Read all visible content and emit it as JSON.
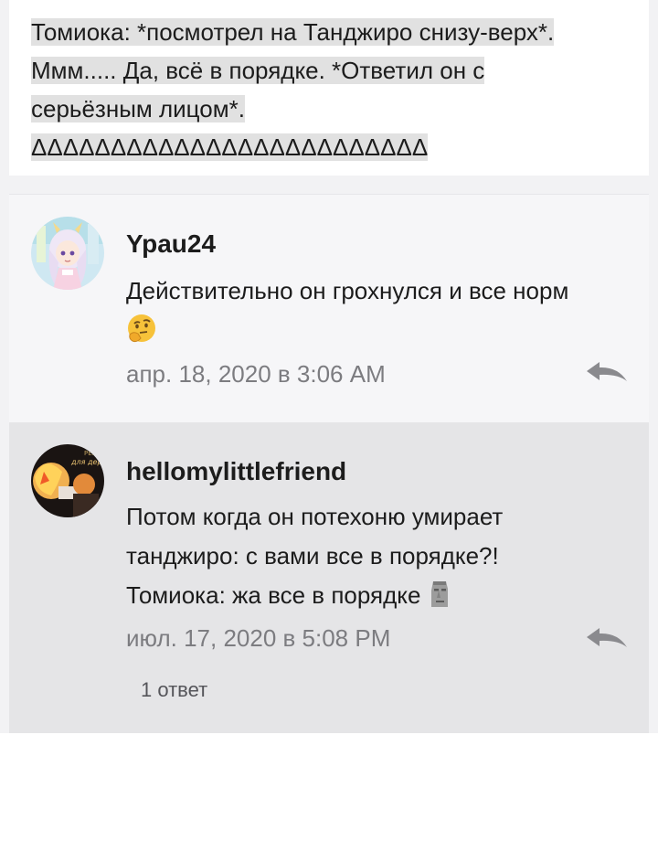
{
  "post": {
    "line1": "Томиока: *посмотрел на Танджиро снизу-верх*.",
    "line2": "Ммм..... Да, всё в порядке. *Ответил он с",
    "line3": "серьёзным лицом*.",
    "line4": "ΔΔΔΔΔΔΔΔΔΔΔΔΔΔΔΔΔΔΔΔΔΔΔΔΔ"
  },
  "comments": [
    {
      "username": "Ypau24",
      "text": "Действительно он грохнулся и все норм",
      "emoji": "thinking-face-emoji",
      "timestamp": "апр. 18, 2020 в 3:06 AM",
      "reply_icon": "reply-arrow-icon"
    },
    {
      "username": "hellomylittlefriend",
      "line1": "Потом когда он потехоню умирает",
      "line2": "танджиро: с вами все в порядке?!",
      "line3": "Томиока: жа все в порядке",
      "emoji": "moai-emoji",
      "timestamp": "июл. 17, 2020 в 5:08 PM",
      "reply_icon": "reply-arrow-icon",
      "replies_label": "1 ответ"
    }
  ],
  "colors": {
    "text": "#1c1c1c",
    "muted": "#7c7c80",
    "highlight": "#e1e1e1",
    "comment1_bg": "#f6f6f8",
    "comment2_bg": "#e5e5e7"
  }
}
